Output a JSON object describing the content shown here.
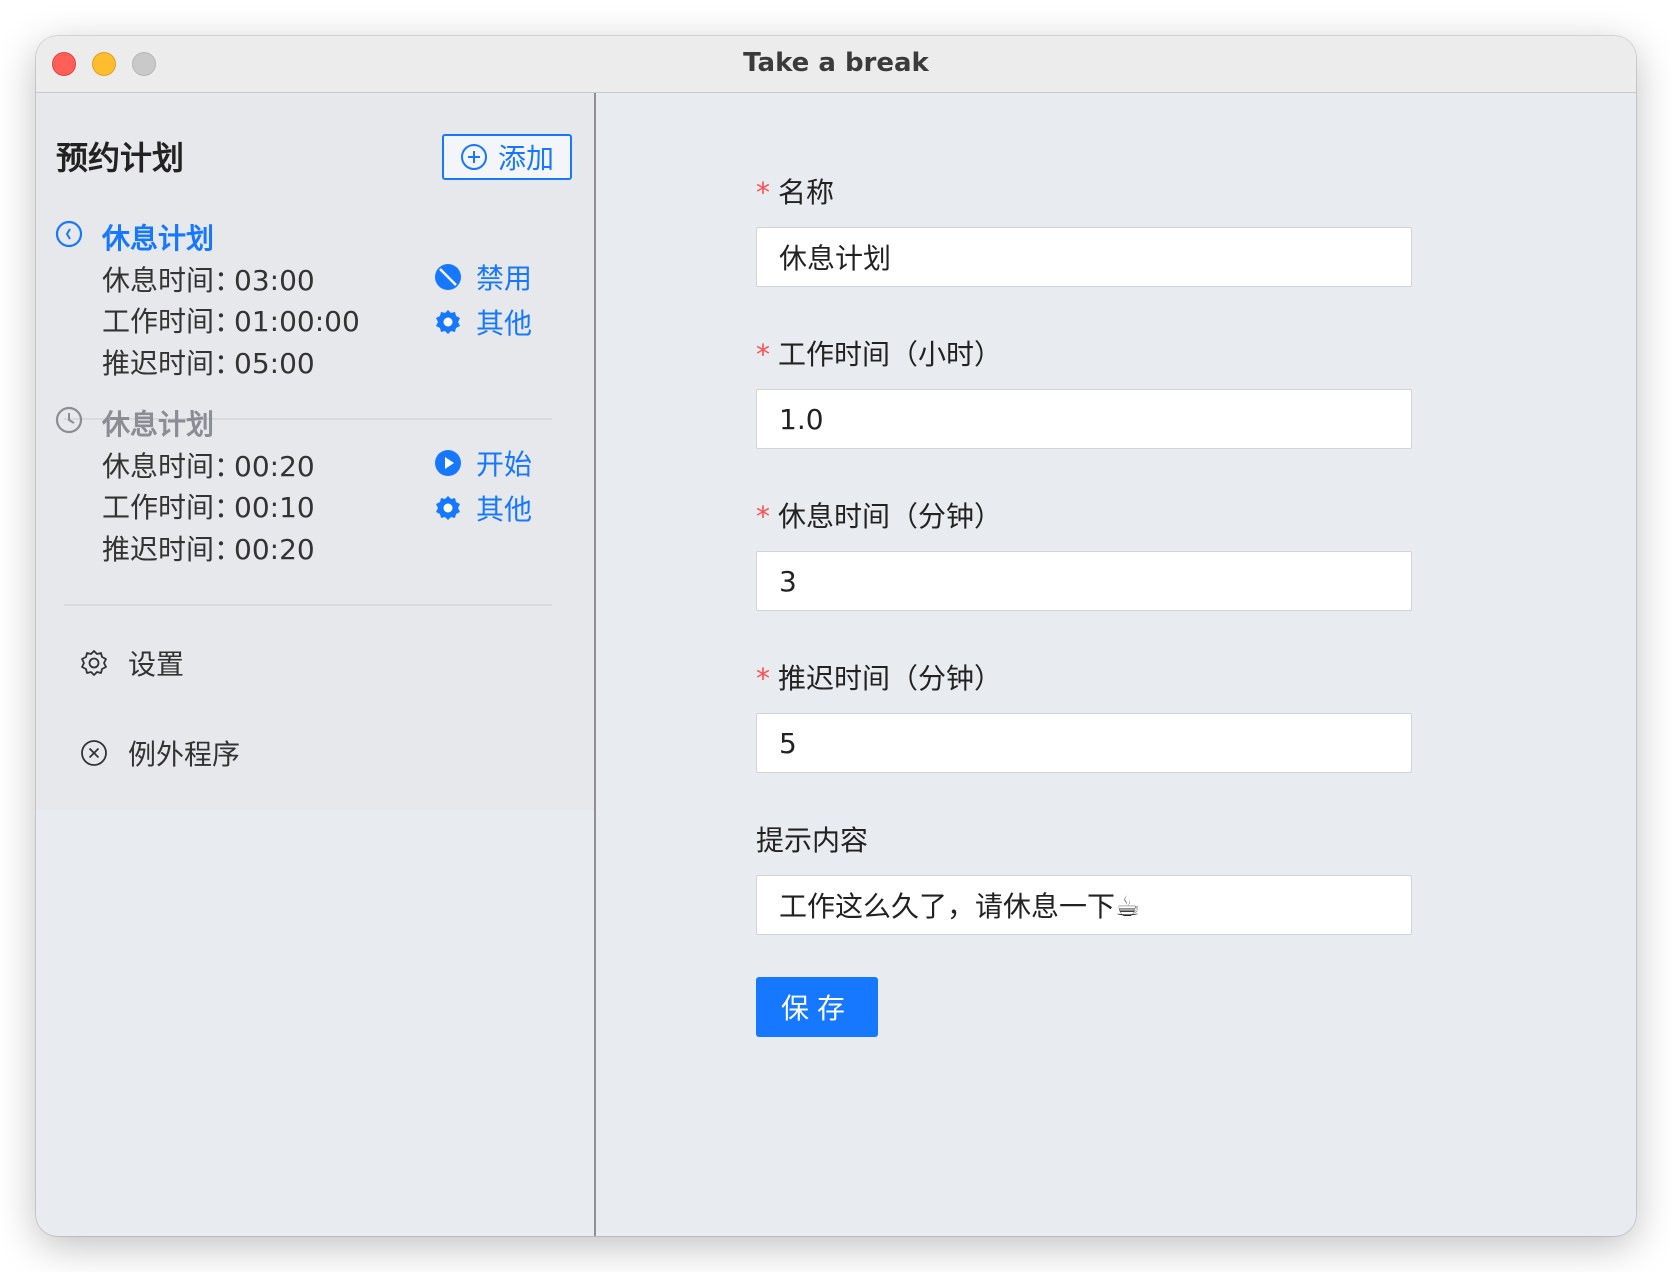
{
  "window": {
    "title": "Take a break"
  },
  "sidebar": {
    "title": "预约计划",
    "add_label": "添加",
    "plans": [
      {
        "name": "休息计划",
        "rest_label": "休息时间：",
        "rest_value": "03:00",
        "work_label": "工作时间：",
        "work_value": "01:00:00",
        "delay_label": "推迟时间：",
        "delay_value": "05:00",
        "primary_action": "禁用",
        "primary_icon": "disable-icon",
        "secondary_action": "其他",
        "secondary_icon": "gear-icon"
      },
      {
        "name": "休息计划",
        "rest_label": "休息时间：",
        "rest_value": "00:20",
        "work_label": "工作时间：",
        "work_value": "00:10",
        "delay_label": "推迟时间：",
        "delay_value": "00:20",
        "primary_action": "开始",
        "primary_icon": "play-icon",
        "secondary_action": "其他",
        "secondary_icon": "gear-icon"
      }
    ],
    "menu": [
      {
        "label": "设置",
        "icon": "settings-icon"
      },
      {
        "label": "例外程序",
        "icon": "close-circle-icon"
      }
    ]
  },
  "form": {
    "name_label": "名称",
    "name_value": "休息计划",
    "work_label": "工作时间（小时）",
    "work_value": "1.0",
    "rest_label": "休息时间（分钟）",
    "rest_value": "3",
    "delay_label": "推迟时间（分钟）",
    "delay_value": "5",
    "tip_label": "提示内容",
    "tip_value": "工作这么久了，请休息一下☕",
    "required_mark": "*",
    "save_label": "保存"
  },
  "colors": {
    "accent": "#1677ff",
    "required": "#ff4d4f",
    "muted": "#8a8d93"
  }
}
